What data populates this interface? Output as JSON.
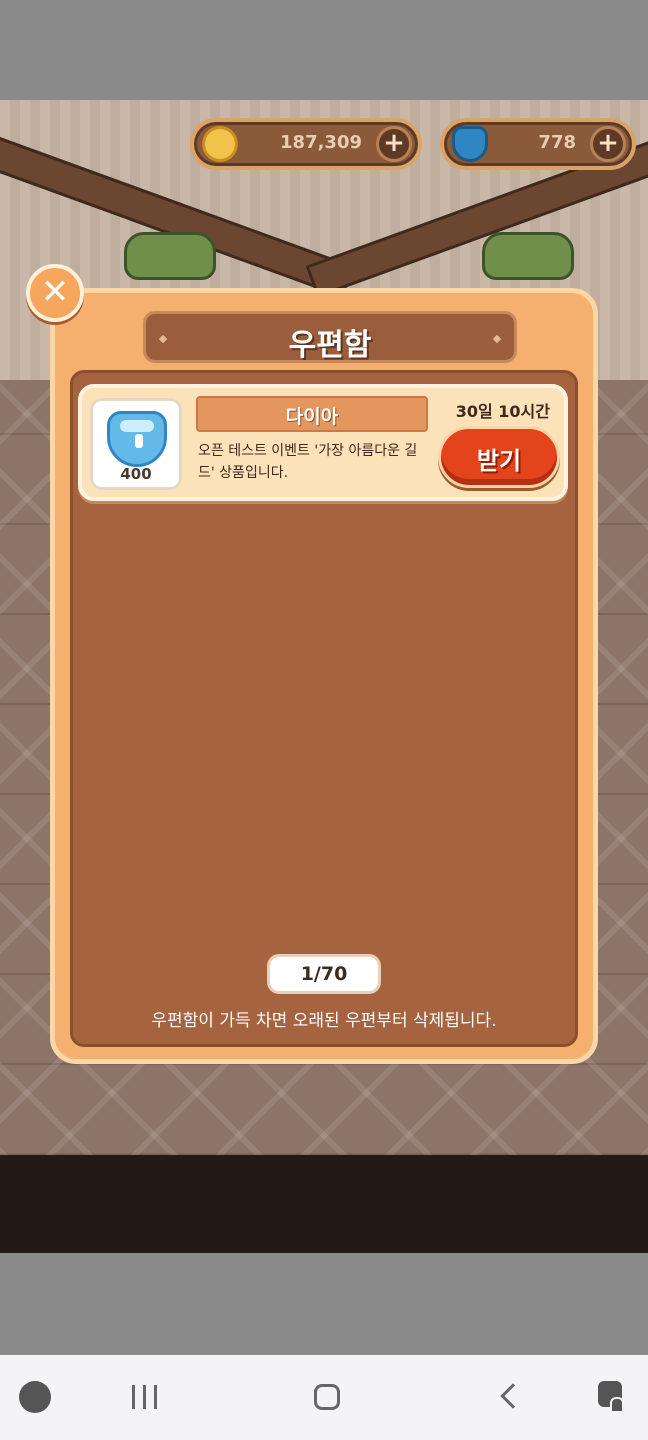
{
  "currency": {
    "cookies": {
      "icon": "moon-coin-icon",
      "value": "187,309",
      "color": "#f2c34a"
    },
    "gems": {
      "icon": "diamond-shield-icon",
      "value": "778",
      "color": "#2f86c2"
    }
  },
  "mailbox": {
    "title": "우편함",
    "items": [
      {
        "name": "다이아",
        "quantity": "400",
        "description": "오픈 테스트 이벤트 '가장 아름다운 길드' 상품입니다.",
        "time_left": "30일 10시간",
        "receive_label": "받기"
      }
    ],
    "page": "1/70",
    "footer_note": "우편함이 가득 차면 오래된 우편부터 삭제됩니다."
  },
  "colors": {
    "accent": "#e4441c",
    "panel": "#f5b06f",
    "inner": "#a5633f"
  },
  "navbar": {
    "icons": [
      "game-tools-icon",
      "recents-icon",
      "home-icon",
      "back-icon",
      "assistant-icon"
    ]
  }
}
